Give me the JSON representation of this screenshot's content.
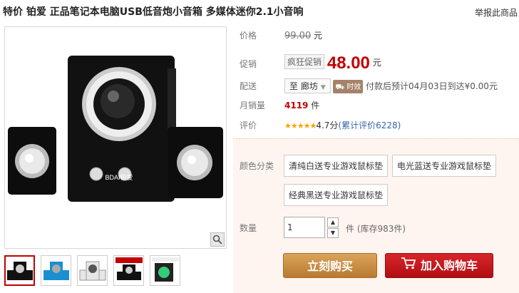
{
  "title": "特价 铂爱 正品笔记本电脑USB低音炮小音箱 多媒体迷你2.1小音响",
  "report_link": "举报此商品",
  "price": {
    "label": "价格",
    "original": "99.00",
    "unit": "元"
  },
  "promo": {
    "label": "促销",
    "tag": "疯狂促销",
    "price": "48.00",
    "unit": "元"
  },
  "delivery": {
    "label": "配送",
    "dest_prefix": "至",
    "destination": "廊坊",
    "badge": "时效",
    "note": "付款后预计04月03日到达¥0.00元"
  },
  "monthly_sales": {
    "label": "月销量",
    "value": "4119",
    "unit": "件"
  },
  "rating": {
    "label": "评价",
    "stars": "★★★★★",
    "score": "4.7分",
    "reviews_link": "(累计评价6228)"
  },
  "color": {
    "label": "颜色分类",
    "options": [
      "清纯白送专业游戏鼠标垫",
      "电光蓝送专业游戏鼠标垫",
      "经典黑送专业游戏鼠标垫"
    ]
  },
  "quantity": {
    "label": "数量",
    "value": "1",
    "unit": "件",
    "stock": "(库存983件)"
  },
  "buttons": {
    "buy_now": "立刻购买",
    "add_to_cart": "加入购物车"
  },
  "product_logo": "BDAI铂爱"
}
